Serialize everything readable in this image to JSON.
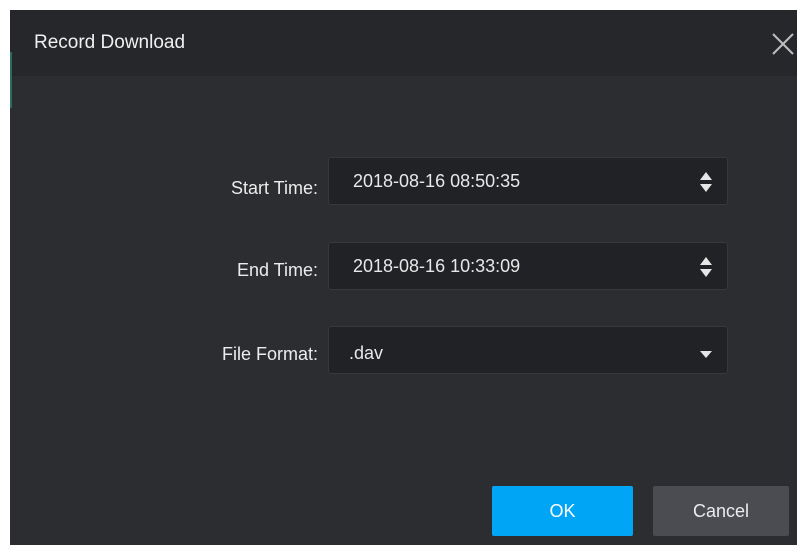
{
  "dialog": {
    "title": "Record Download"
  },
  "form": {
    "start_time": {
      "label": "Start Time:",
      "value": "2018-08-16 08:50:35"
    },
    "end_time": {
      "label": "End Time:",
      "value": "2018-08-16 10:33:09"
    },
    "file_format": {
      "label": "File Format:",
      "value": ".dav"
    }
  },
  "buttons": {
    "ok_label": "OK",
    "cancel_label": "Cancel"
  },
  "icons": {
    "close": "close-icon",
    "spin": "spinner-arrows-icon",
    "dropdown": "chevron-down-icon"
  },
  "colors": {
    "dialog_bg": "#2b2d31",
    "titlebar_bg": "#25272b",
    "field_bg": "#212226",
    "accent": "#00a5f5",
    "secondary_button": "#4a4c51"
  }
}
